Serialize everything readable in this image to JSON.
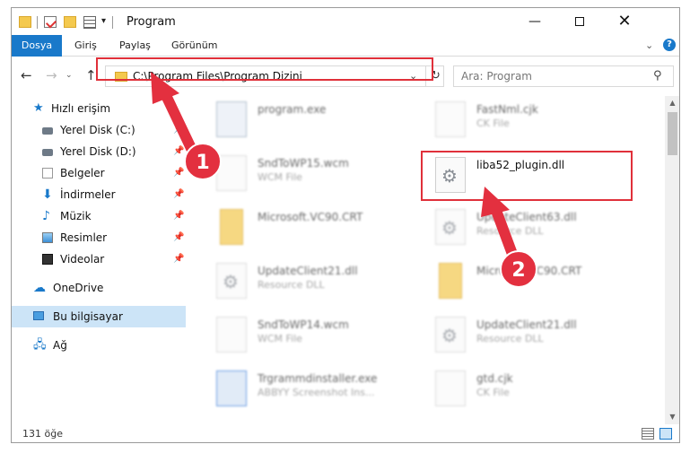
{
  "window": {
    "title": "Program",
    "min_label": "—",
    "close_label": "✕"
  },
  "ribbon": {
    "tabs": [
      "Dosya",
      "Giriş",
      "Paylaş",
      "Görünüm"
    ],
    "chevron": "⌄",
    "help": "?"
  },
  "nav": {
    "back": "←",
    "forward": "→",
    "recent": "⌄",
    "up": "↑",
    "address": "C:\\Program Files\\Program Dizini",
    "dropdown": "⌄",
    "refresh": "↻",
    "search_placeholder": "Ara: Program",
    "search_icon": "⚲"
  },
  "sidebar": {
    "items": [
      {
        "label": "Hızlı erişim",
        "icon": "star-icon",
        "pin": ""
      },
      {
        "label": "Yerel Disk (C:)",
        "icon": "drive-icon",
        "pin": "📌"
      },
      {
        "label": "Yerel Disk (D:)",
        "icon": "drive-icon",
        "pin": "📌"
      },
      {
        "label": "Belgeler",
        "icon": "documents-icon",
        "pin": "📌"
      },
      {
        "label": "İndirmeler",
        "icon": "download-icon",
        "pin": "📌"
      },
      {
        "label": "Müzik",
        "icon": "music-icon",
        "pin": "📌"
      },
      {
        "label": "Resimler",
        "icon": "pictures-icon",
        "pin": "📌"
      },
      {
        "label": "Videolar",
        "icon": "videos-icon",
        "pin": "📌"
      },
      {
        "label": "OneDrive",
        "icon": "cloud-icon",
        "pin": ""
      },
      {
        "label": "Bu bilgisayar",
        "icon": "computer-icon",
        "pin": ""
      },
      {
        "label": "Ağ",
        "icon": "network-icon",
        "pin": ""
      }
    ]
  },
  "files": [
    {
      "name": "program.exe",
      "sub": "",
      "kind": "exe"
    },
    {
      "name": "FastNml.cjk",
      "sub": "CK File",
      "kind": "doc"
    },
    {
      "name": "SndToWP15.wcm",
      "sub": "WCM File",
      "kind": "doc"
    },
    {
      "name": "liba52_plugin.dll",
      "sub": "",
      "kind": "dll"
    },
    {
      "name": "Microsoft.VC90.CRT",
      "sub": "",
      "kind": "folder"
    },
    {
      "name": "UpdateClient63.dll",
      "sub": "Resource DLL",
      "kind": "dll"
    },
    {
      "name": "UpdateClient21.dll",
      "sub": "Resource DLL",
      "kind": "dll"
    },
    {
      "name": "Microsoft.VC90.CRT",
      "sub": "",
      "kind": "folder"
    },
    {
      "name": "SndToWP14.wcm",
      "sub": "WCM File",
      "kind": "doc"
    },
    {
      "name": "UpdateClient21.dll",
      "sub": "Resource DLL",
      "kind": "dll"
    },
    {
      "name": "Trgrammdinstaller.exe",
      "sub": "ABBYY Screenshot Ins...",
      "kind": "app"
    },
    {
      "name": "gtd.cjk",
      "sub": "CK File",
      "kind": "doc"
    }
  ],
  "callouts": {
    "one": "1",
    "two": "2"
  },
  "status": {
    "count": "131 öğe"
  },
  "colors": {
    "accent": "#1979ca",
    "highlight": "#e0303a",
    "selected": "#cce4f7"
  }
}
